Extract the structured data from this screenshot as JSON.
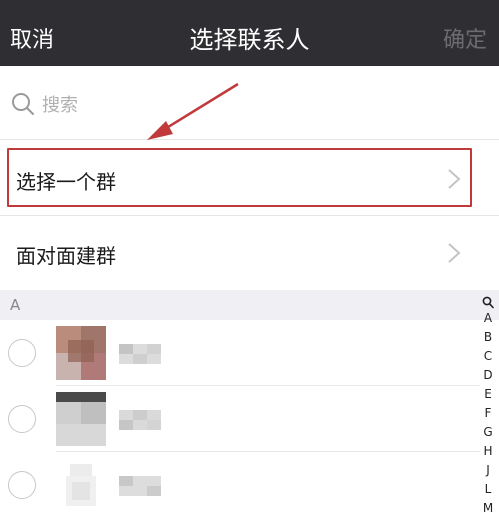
{
  "nav": {
    "cancel": "取消",
    "title": "选择联系人",
    "confirm": "确定"
  },
  "search": {
    "placeholder": "搜索"
  },
  "rows": [
    {
      "label": "选择一个群"
    },
    {
      "label": "面对面建群"
    }
  ],
  "section": {
    "letter": "A"
  },
  "index": [
    "A",
    "B",
    "C",
    "D",
    "E",
    "F",
    "G",
    "H",
    "J",
    "L",
    "M"
  ],
  "colors": {
    "nav_bg": "#2f2f33",
    "highlight": "#c0393b",
    "confirm_disabled": "#6b6b70"
  }
}
